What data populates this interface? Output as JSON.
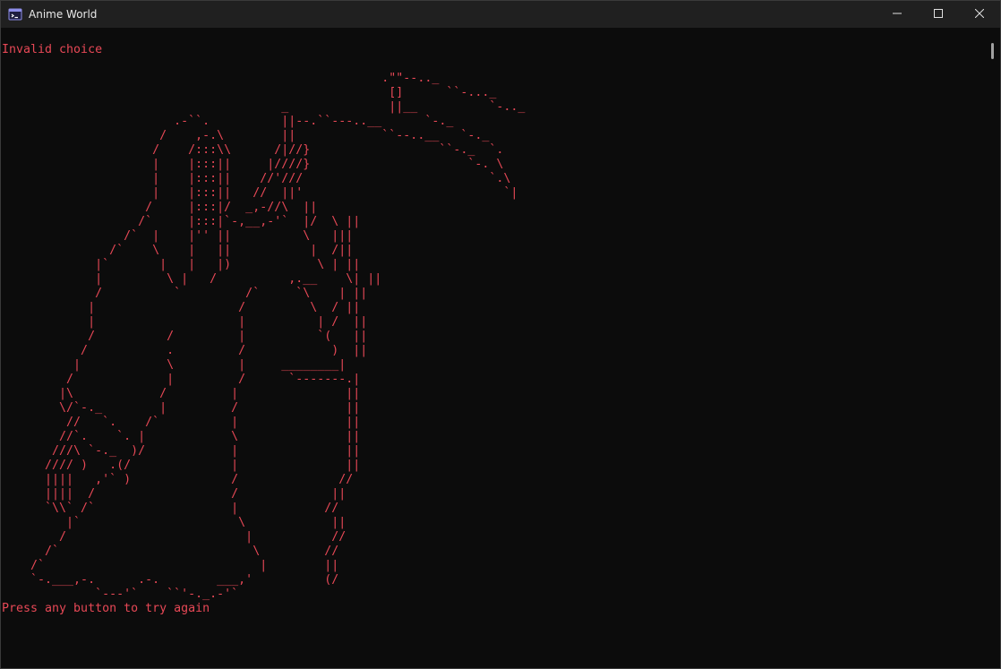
{
  "window": {
    "title": "Anime World",
    "icon": "console-app-icon",
    "controls": [
      "minimize-icon",
      "maximize-icon",
      "close-icon"
    ]
  },
  "console": {
    "text_color": "#e74856",
    "background": "#0c0c0c",
    "message": "Invalid choice",
    "ascii_art": "                                                     .\"\"--.._\n                                                      []      ``-..._\n                                       _              ||__          `-.._\n                        .-``.          ||--.``---..__      `-._\n                      /    ,-.\\        ||            ``--..__   `-._\n                     /    /:::\\\\      /|//}                  ``-._  `.\n                     |    |:::||     |////}                      `-. \\\n                     |    |:::||    //'///                          `.\\\n                     |    |:::||   //  ||'                            `|\n                    /     |:::|/  _,-//\\  ||\n                   /`     |:::|`-,__,-'`  |/  \\ ||\n                 /`  |    |'' ||          \\   |||\n               /`    \\    |   ||           |  /||\n             |`       |   |   |)            \\ | ||\n             |         \\ |   /          ,.__    \\| ||\n             /          `         /`     `\\    | ||\n            |                    /         \\  / ||\n            |                    |          | /  ||\n            /          /         |          `(   ||\n           /           .         /            )  ||\n          |            \\         |     ________|\n         /             |         /      `-------.|\n        |\\            /         |               ||\n        \\/`-._        |         /               ||\n         //   `.    /`          |               ||\n        //`.    `. |            \\               ||\n       ///\\ `-._  )/            |               ||\n      //// )   .(/              |               ||\n      ||||   ,'` )              /              //\n      ||||  /                   /             ||\n      `\\\\` /`                   |            //\n         |`                      \\            ||\n        /                         |           //\n      /`                           \\         //\n    /`                              |        ||\n    `-.___,-.      .-.        ___,'          (/\n             `---'`    ``'-._.-'`",
    "prompt": "Press any button to try again"
  }
}
